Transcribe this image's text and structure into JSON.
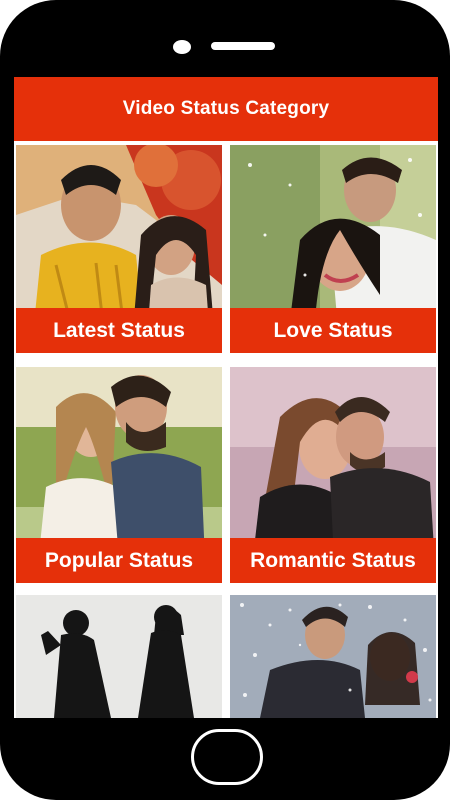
{
  "app": {
    "title": "Video Status Category"
  },
  "categories": [
    {
      "label": "Latest Status"
    },
    {
      "label": "Love Status"
    },
    {
      "label": "Popular Status"
    },
    {
      "label": "Romantic Status"
    },
    {
      "label": ""
    },
    {
      "label": ""
    }
  ],
  "colors": {
    "accent": "#e5300a",
    "device": "#000000"
  }
}
